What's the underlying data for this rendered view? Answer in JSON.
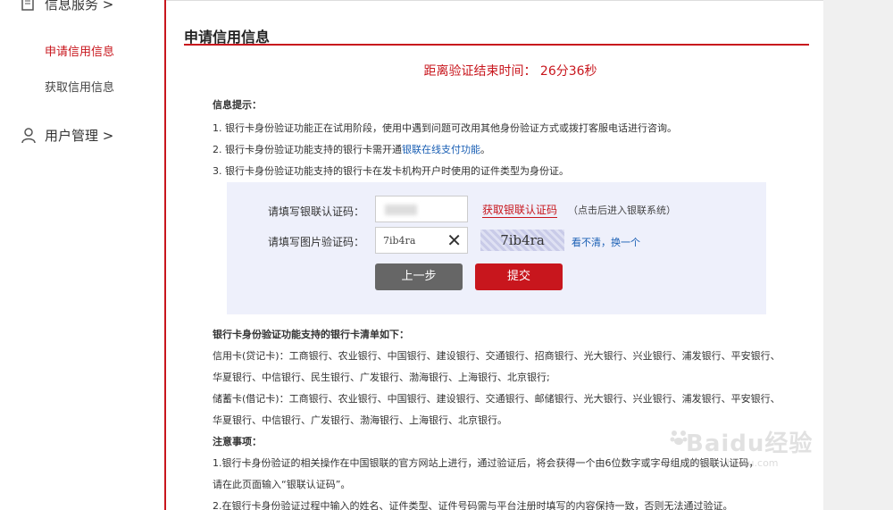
{
  "sidebar": {
    "group_top_label": "信息服务 >",
    "items": [
      {
        "label": "申请信用信息",
        "active": true
      },
      {
        "label": "获取信用信息",
        "active": false
      }
    ],
    "user_group_label": "用户管理 >"
  },
  "main": {
    "title": "申请信用信息",
    "countdown_prefix": "距离验证结束时间：",
    "countdown_value": "26分36秒",
    "info_heading": "信息提示：",
    "info_lines": [
      "1. 银行卡身份验证功能正在试用阶段，使用中遇到问题可改用其他身份验证方式或拨打客服电话进行咨询。",
      "2. 银行卡身份验证功能支持的银行卡需开通",
      "3. 银行卡身份验证功能支持的银行卡在发卡机构开户时使用的证件类型为身份证。"
    ],
    "info_link": "银联在线支付功能",
    "info_line2_suffix": "。",
    "form": {
      "unionpay_label": "请填写银联认证码：",
      "get_code_label": "获取银联认证码",
      "get_code_hint": "（点击后进入银联系统）",
      "captcha_label": "请填写图片验证码：",
      "captcha_value": "7ib4ra",
      "captcha_image_text": "7ib4ra",
      "refresh_label": "看不清，换一个",
      "back_label": "上一步",
      "submit_label": "提交"
    },
    "banks_heading": "银行卡身份验证功能支持的银行卡清单如下：",
    "bank_lines": [
      "信用卡(贷记卡)：工商银行、农业银行、中国银行、建设银行、交通银行、招商银行、光大银行、兴业银行、浦发银行、平安银行、",
      "华夏银行、中信银行、民生银行、广发银行、渤海银行、上海银行、北京银行;",
      "储蓄卡(借记卡)：工商银行、农业银行、中国银行、建设银行、交通银行、邮储银行、光大银行、兴业银行、浦发银行、平安银行、",
      "华夏银行、中信银行、广发银行、渤海银行、上海银行、北京银行。"
    ],
    "notes_heading": "注意事项：",
    "note_lines": [
      "1.银行卡身份验证的相关操作在中国银联的官方网站上进行，通过验证后，将会获得一个由6位数字或字母组成的银联认证码，",
      "请在此页面输入“银联认证码”。",
      "2.在银行卡身份验证过程中输入的姓名、证件类型、证件号码需与平台注册时填写的内容保持一致，否则无法通过验证。"
    ]
  },
  "watermark": {
    "brand": "Baidu经验",
    "url": "jingyan.baidu.com"
  }
}
